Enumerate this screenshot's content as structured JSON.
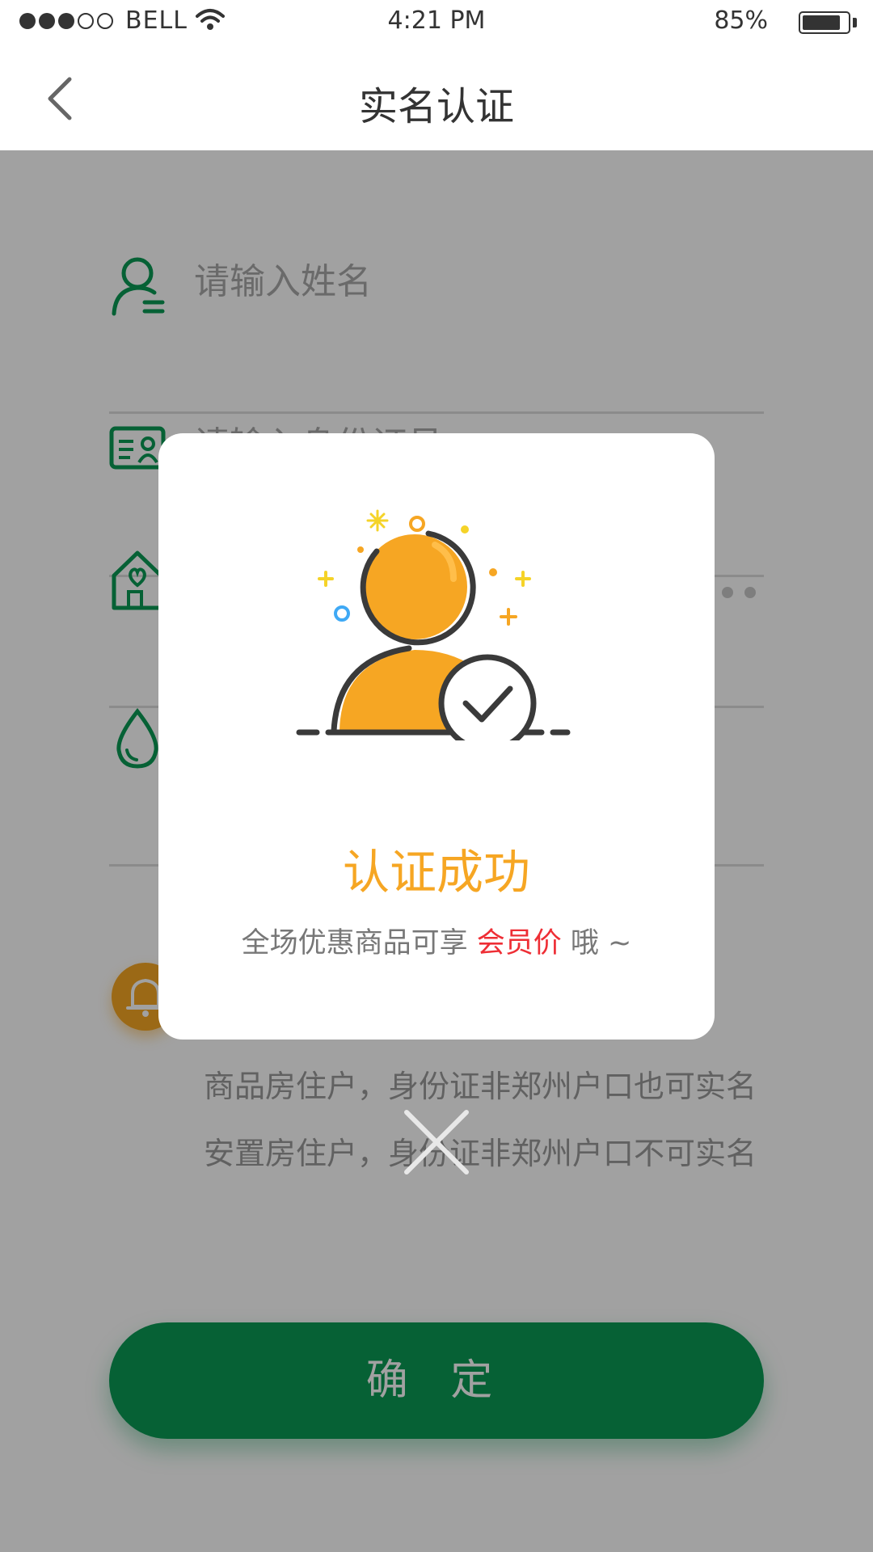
{
  "status_bar": {
    "carrier": "BELL",
    "time": "4:21 PM",
    "battery_percent": "85%",
    "battery_level": 0.85,
    "signal_bars": 3,
    "signal_total": 5
  },
  "nav": {
    "title": "实名认证"
  },
  "form": {
    "name_placeholder": "请输入姓名",
    "id_placeholder": "请输入身份证号"
  },
  "notice": {
    "line1": "商品房住户，身份证非郑州户口也可实名",
    "line2": "安置房住户，身份证非郑州户口不可实名"
  },
  "confirm_label": "确 定",
  "modal": {
    "title": "认证成功",
    "subtitle_prefix": "全场优惠商品可享 ",
    "subtitle_highlight": "会员价",
    "subtitle_suffix": " 哦 ~"
  },
  "colors": {
    "brand_green": "#0b9a55",
    "accent_orange": "#f6a623",
    "highlight_red": "#ee2e35"
  }
}
